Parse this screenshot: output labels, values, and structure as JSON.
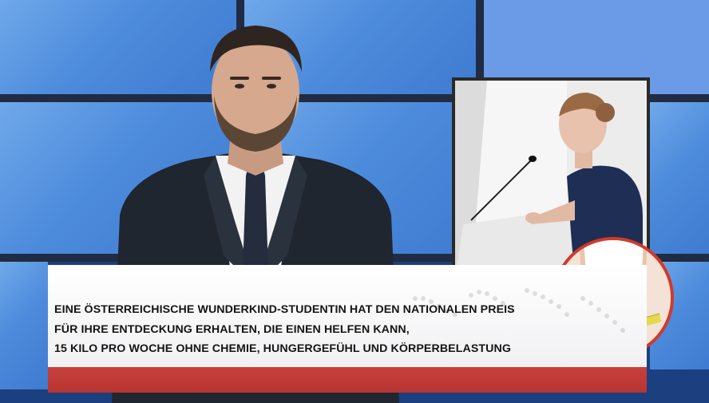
{
  "headline": {
    "line1": "EINE ÖSTERREICHISCHE WUNDERKIND-STUDENTIN HAT DEN NATIONALEN PREIS",
    "line2": "FÜR IHRE ENTDECKUNG ERHALTEN,  DIE EINEN HELFEN KANN,",
    "line3": "15 KILO PRO WOCHE OHNE CHEMIE, HUNGERGEFÜHL UND KÖRPERBELASTUNG"
  },
  "colors": {
    "studio_blue": "#4d8bdc",
    "banner_red": "#b73532",
    "badge_ring": "#d23a2a"
  }
}
